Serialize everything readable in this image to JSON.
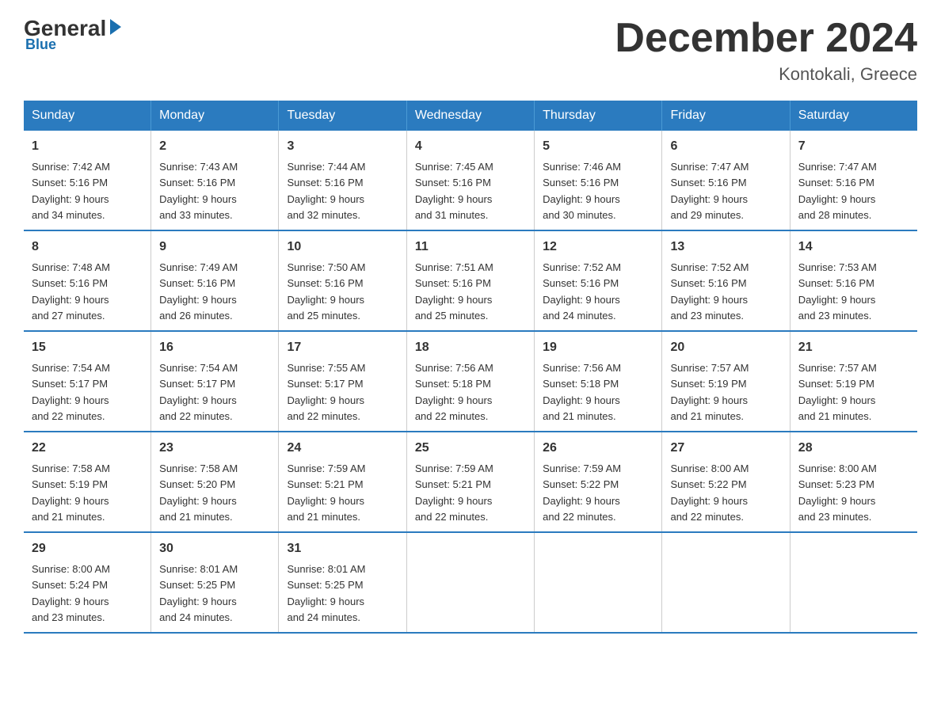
{
  "logo": {
    "general": "General",
    "arrow": "▶",
    "blue": "Blue"
  },
  "title": "December 2024",
  "location": "Kontokali, Greece",
  "days_of_week": [
    "Sunday",
    "Monday",
    "Tuesday",
    "Wednesday",
    "Thursday",
    "Friday",
    "Saturday"
  ],
  "weeks": [
    [
      {
        "day": "1",
        "sunrise": "7:42 AM",
        "sunset": "5:16 PM",
        "daylight": "9 hours and 34 minutes."
      },
      {
        "day": "2",
        "sunrise": "7:43 AM",
        "sunset": "5:16 PM",
        "daylight": "9 hours and 33 minutes."
      },
      {
        "day": "3",
        "sunrise": "7:44 AM",
        "sunset": "5:16 PM",
        "daylight": "9 hours and 32 minutes."
      },
      {
        "day": "4",
        "sunrise": "7:45 AM",
        "sunset": "5:16 PM",
        "daylight": "9 hours and 31 minutes."
      },
      {
        "day": "5",
        "sunrise": "7:46 AM",
        "sunset": "5:16 PM",
        "daylight": "9 hours and 30 minutes."
      },
      {
        "day": "6",
        "sunrise": "7:47 AM",
        "sunset": "5:16 PM",
        "daylight": "9 hours and 29 minutes."
      },
      {
        "day": "7",
        "sunrise": "7:47 AM",
        "sunset": "5:16 PM",
        "daylight": "9 hours and 28 minutes."
      }
    ],
    [
      {
        "day": "8",
        "sunrise": "7:48 AM",
        "sunset": "5:16 PM",
        "daylight": "9 hours and 27 minutes."
      },
      {
        "day": "9",
        "sunrise": "7:49 AM",
        "sunset": "5:16 PM",
        "daylight": "9 hours and 26 minutes."
      },
      {
        "day": "10",
        "sunrise": "7:50 AM",
        "sunset": "5:16 PM",
        "daylight": "9 hours and 25 minutes."
      },
      {
        "day": "11",
        "sunrise": "7:51 AM",
        "sunset": "5:16 PM",
        "daylight": "9 hours and 25 minutes."
      },
      {
        "day": "12",
        "sunrise": "7:52 AM",
        "sunset": "5:16 PM",
        "daylight": "9 hours and 24 minutes."
      },
      {
        "day": "13",
        "sunrise": "7:52 AM",
        "sunset": "5:16 PM",
        "daylight": "9 hours and 23 minutes."
      },
      {
        "day": "14",
        "sunrise": "7:53 AM",
        "sunset": "5:16 PM",
        "daylight": "9 hours and 23 minutes."
      }
    ],
    [
      {
        "day": "15",
        "sunrise": "7:54 AM",
        "sunset": "5:17 PM",
        "daylight": "9 hours and 22 minutes."
      },
      {
        "day": "16",
        "sunrise": "7:54 AM",
        "sunset": "5:17 PM",
        "daylight": "9 hours and 22 minutes."
      },
      {
        "day": "17",
        "sunrise": "7:55 AM",
        "sunset": "5:17 PM",
        "daylight": "9 hours and 22 minutes."
      },
      {
        "day": "18",
        "sunrise": "7:56 AM",
        "sunset": "5:18 PM",
        "daylight": "9 hours and 22 minutes."
      },
      {
        "day": "19",
        "sunrise": "7:56 AM",
        "sunset": "5:18 PM",
        "daylight": "9 hours and 21 minutes."
      },
      {
        "day": "20",
        "sunrise": "7:57 AM",
        "sunset": "5:19 PM",
        "daylight": "9 hours and 21 minutes."
      },
      {
        "day": "21",
        "sunrise": "7:57 AM",
        "sunset": "5:19 PM",
        "daylight": "9 hours and 21 minutes."
      }
    ],
    [
      {
        "day": "22",
        "sunrise": "7:58 AM",
        "sunset": "5:19 PM",
        "daylight": "9 hours and 21 minutes."
      },
      {
        "day": "23",
        "sunrise": "7:58 AM",
        "sunset": "5:20 PM",
        "daylight": "9 hours and 21 minutes."
      },
      {
        "day": "24",
        "sunrise": "7:59 AM",
        "sunset": "5:21 PM",
        "daylight": "9 hours and 21 minutes."
      },
      {
        "day": "25",
        "sunrise": "7:59 AM",
        "sunset": "5:21 PM",
        "daylight": "9 hours and 22 minutes."
      },
      {
        "day": "26",
        "sunrise": "7:59 AM",
        "sunset": "5:22 PM",
        "daylight": "9 hours and 22 minutes."
      },
      {
        "day": "27",
        "sunrise": "8:00 AM",
        "sunset": "5:22 PM",
        "daylight": "9 hours and 22 minutes."
      },
      {
        "day": "28",
        "sunrise": "8:00 AM",
        "sunset": "5:23 PM",
        "daylight": "9 hours and 23 minutes."
      }
    ],
    [
      {
        "day": "29",
        "sunrise": "8:00 AM",
        "sunset": "5:24 PM",
        "daylight": "9 hours and 23 minutes."
      },
      {
        "day": "30",
        "sunrise": "8:01 AM",
        "sunset": "5:25 PM",
        "daylight": "9 hours and 24 minutes."
      },
      {
        "day": "31",
        "sunrise": "8:01 AM",
        "sunset": "5:25 PM",
        "daylight": "9 hours and 24 minutes."
      },
      null,
      null,
      null,
      null
    ]
  ],
  "labels": {
    "sunrise_prefix": "Sunrise: ",
    "sunset_prefix": "Sunset: ",
    "daylight_prefix": "Daylight: "
  }
}
